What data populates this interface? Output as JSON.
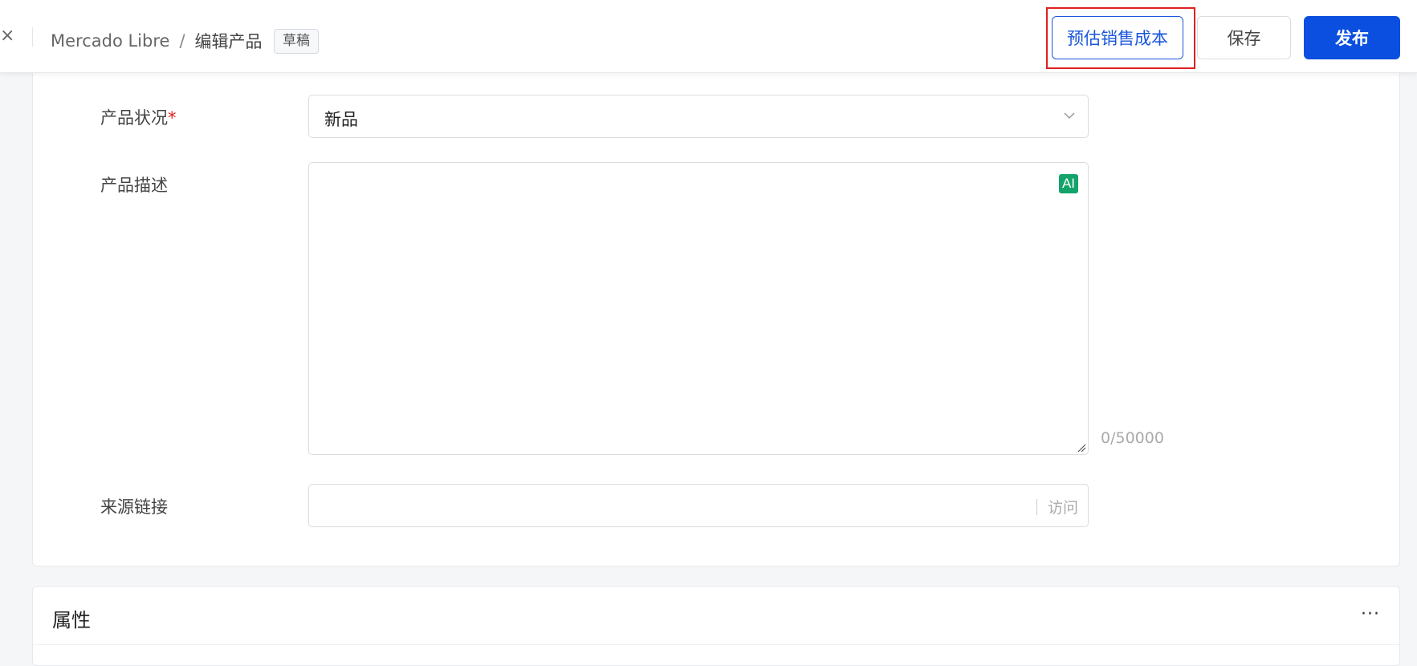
{
  "header": {
    "breadcrumb": {
      "channel": "Mercado Libre",
      "separator": "/",
      "current": "编辑产品"
    },
    "status_badge": "草稿",
    "buttons": {
      "estimate_cost": "预估销售成本",
      "save": "保存",
      "publish": "发布"
    },
    "highlight_color": "#e02020",
    "accent_color": "#0b4fe0"
  },
  "form": {
    "condition": {
      "label": "产品状况",
      "required_mark": "*",
      "value": "新品"
    },
    "description": {
      "label": "产品描述",
      "value": "",
      "ai_badge": "AI",
      "char_count": "0/50000"
    },
    "source_link": {
      "label": "来源链接",
      "value": "",
      "suffix": "访问"
    }
  },
  "attributes_section": {
    "title": "属性",
    "more": "···"
  },
  "icons": [
    "close-icon",
    "chevron-down-icon",
    "ai-icon",
    "resize-handle-icon",
    "more-icon"
  ]
}
